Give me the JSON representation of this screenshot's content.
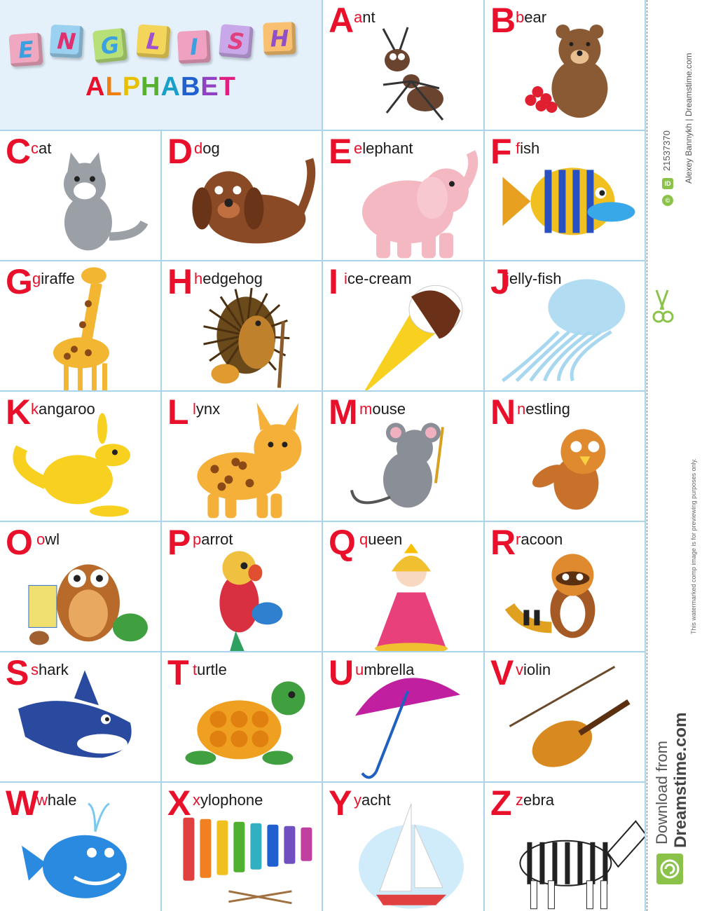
{
  "header": {
    "title_letters": [
      "E",
      "N",
      "G",
      "L",
      "I",
      "S",
      "H"
    ],
    "subtitle_letters": [
      "A",
      "L",
      "P",
      "H",
      "A",
      "B",
      "E",
      "T"
    ]
  },
  "colors": {
    "cube_colors": [
      "#f0a8c0",
      "#9ad0f0",
      "#b8e078",
      "#f3d55a",
      "#f0a0c0",
      "#c8a8e8",
      "#f8c070"
    ],
    "cube_text_colors": [
      "#3aa0e0",
      "#e03070",
      "#3aa0e0",
      "#a050d0",
      "#3aa0e0",
      "#e04080",
      "#9050c8"
    ],
    "subtitle_colors": [
      "#e8102a",
      "#f08010",
      "#e8c000",
      "#58b030",
      "#1aa0c8",
      "#2060d0",
      "#9040c0",
      "#e02080"
    ],
    "letter_red": "#e8102a",
    "grid_line": "#a8d4ec",
    "title_bg": "#e4f1fb"
  },
  "cells": [
    {
      "letter": "A",
      "word": "ant",
      "icon": "ant-icon",
      "tint": "#6b4430"
    },
    {
      "letter": "B",
      "word": "bear",
      "icon": "bear-icon",
      "tint": "#8a5a35"
    },
    {
      "letter": "C",
      "word": "cat",
      "icon": "cat-icon",
      "tint": "#9aa0a6"
    },
    {
      "letter": "D",
      "word": "dog",
      "icon": "dog-icon",
      "tint": "#8b4a26"
    },
    {
      "letter": "E",
      "word": "elephant",
      "icon": "elephant-icon",
      "tint": "#f4b8c2"
    },
    {
      "letter": "F",
      "word": "fish",
      "icon": "fish-icon",
      "tint": "#f0c020"
    },
    {
      "letter": "G",
      "word": "giraffe",
      "icon": "giraffe-icon",
      "tint": "#f2b632"
    },
    {
      "letter": "H",
      "word": "hedgehog",
      "icon": "hedgehog-icon",
      "tint": "#c0812c"
    },
    {
      "letter": "I",
      "word": "ice-cream",
      "icon": "ice-cream-icon",
      "tint": "#f8d020"
    },
    {
      "letter": "J",
      "word": "jelly-fish",
      "icon": "jellyfish-icon",
      "tint": "#a8d8f0"
    },
    {
      "letter": "K",
      "word": "kangaroo",
      "icon": "kangaroo-icon",
      "tint": "#f8d020"
    },
    {
      "letter": "L",
      "word": "lynx",
      "icon": "lynx-icon",
      "tint": "#f5b03a"
    },
    {
      "letter": "M",
      "word": "mouse",
      "icon": "mouse-icon",
      "tint": "#8a8e96"
    },
    {
      "letter": "N",
      "word": "nestling",
      "icon": "nestling-icon",
      "tint": "#c8712a"
    },
    {
      "letter": "O",
      "word": "owl",
      "icon": "owl-icon",
      "tint": "#b86a2a"
    },
    {
      "letter": "P",
      "word": "parrot",
      "icon": "parrot-icon",
      "tint": "#d83040"
    },
    {
      "letter": "Q",
      "word": "queen",
      "icon": "queen-icon",
      "tint": "#e8407a"
    },
    {
      "letter": "R",
      "word": "racoon",
      "icon": "racoon-icon",
      "tint": "#a55a25"
    },
    {
      "letter": "S",
      "word": "shark",
      "icon": "shark-icon",
      "tint": "#2a4aa0"
    },
    {
      "letter": "T",
      "word": "turtle",
      "icon": "turtle-icon",
      "tint": "#f0a020"
    },
    {
      "letter": "U",
      "word": "umbrella",
      "icon": "umbrella-icon",
      "tint": "#c020a0"
    },
    {
      "letter": "V",
      "word": "violin",
      "icon": "violin-icon",
      "tint": "#d88a20"
    },
    {
      "letter": "W",
      "word": "whale",
      "icon": "whale-icon",
      "tint": "#2a8ae0"
    },
    {
      "letter": "X",
      "word": "xylophone",
      "icon": "xylophone-icon",
      "tint": "#e04040"
    },
    {
      "letter": "Y",
      "word": "yacht",
      "icon": "yacht-icon",
      "tint": "#4ab0e8"
    },
    {
      "letter": "Z",
      "word": "zebra",
      "icon": "zebra-icon",
      "tint": "#222222"
    }
  ],
  "sidebar": {
    "id_badge": "ID",
    "id_number": "21537370",
    "copyright_badge": "©",
    "credit": "Alexey Bannykh | Dreamstime.com",
    "disclaimer": "This watermarked comp image is for previewing purposes only.",
    "download_from": "Download from",
    "site": "Dreamstime.com"
  }
}
